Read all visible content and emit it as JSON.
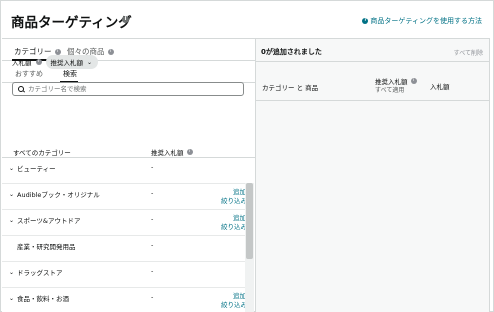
{
  "header": {
    "title": "商品ターゲティング",
    "help_link": "商品ターゲティングを使用する方法"
  },
  "tabs": [
    {
      "label": "カテゴリー",
      "active": true
    },
    {
      "label": "個々の商品",
      "active": false
    }
  ],
  "subtabs": [
    {
      "label": "おすすめ",
      "active": false
    },
    {
      "label": "検索",
      "active": true
    }
  ],
  "bid": {
    "label": "入札額",
    "dropdown_value": "推奨入札額"
  },
  "search": {
    "placeholder": "カテゴリー名で検索"
  },
  "table": {
    "columns": [
      "すべてのカテゴリー",
      "推奨入札額"
    ],
    "rows": [
      {
        "name": "ビューティー",
        "bid": "-",
        "actions": [],
        "expandable": true
      },
      {
        "name": "Audibleブック・オリジナル",
        "bid": "-",
        "actions": [
          "追加",
          "絞り込み"
        ],
        "expandable": true
      },
      {
        "name": "スポーツ&アウトドア",
        "bid": "-",
        "actions": [
          "追加",
          "絞り込み"
        ],
        "expandable": true
      },
      {
        "name": "産業・研究開発用品",
        "bid": "-",
        "actions": [],
        "expandable": false
      },
      {
        "name": "ドラッグストア",
        "bid": "-",
        "actions": [],
        "expandable": true
      },
      {
        "name": "食品・飲料・お酒",
        "bid": "-",
        "actions": [
          "追加",
          "絞り込み"
        ],
        "expandable": true
      }
    ]
  },
  "added_panel": {
    "title": "0が追加されました",
    "remove_all": "すべて削除",
    "col_category": "カテゴリー と 商品",
    "col_suggested": "推奨入札額",
    "col_suggested_sub": "すべて適用",
    "col_bid": "入札額"
  },
  "colors": {
    "link": "#007185",
    "text": "#0f1111",
    "panel_bg": "#f7f8f8",
    "pill_bg": "#e3e6e6"
  },
  "icons": {
    "info": "info-icon",
    "help": "question-circle-icon",
    "search": "search-icon",
    "expand": "chevron-down-icon"
  }
}
